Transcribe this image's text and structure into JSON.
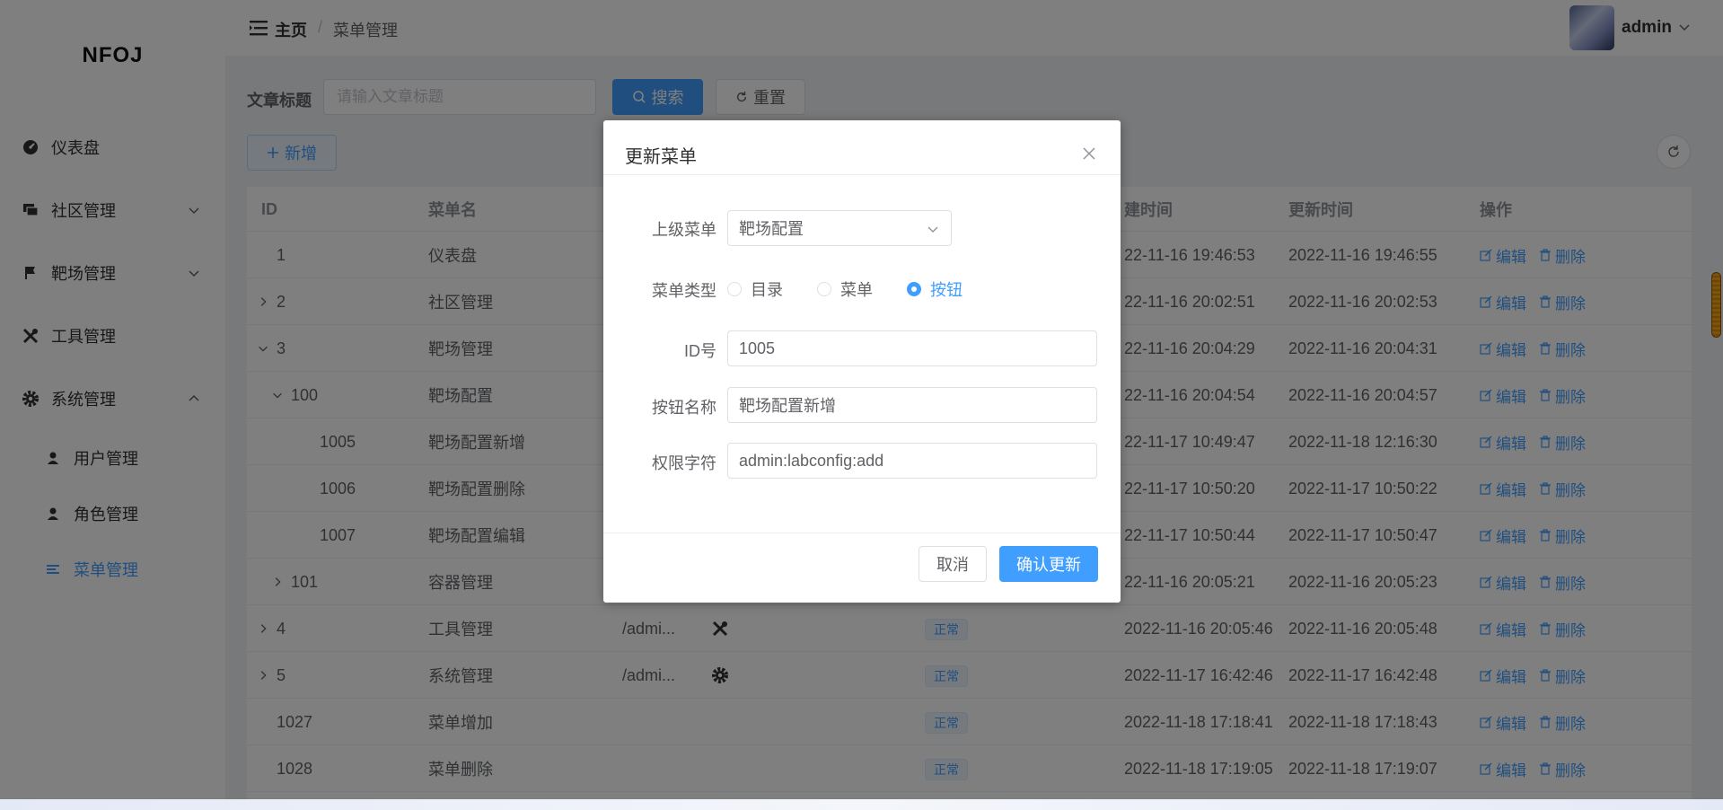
{
  "sidebar": {
    "logo": "NFOJ",
    "items": [
      {
        "label": "仪表盘",
        "icon": "dashboard-icon"
      },
      {
        "label": "社区管理",
        "icon": "chat-icon"
      },
      {
        "label": "靶场管理",
        "icon": "flag-icon"
      },
      {
        "label": "工具管理",
        "icon": "tools-icon"
      },
      {
        "label": "系统管理",
        "icon": "gear-icon"
      }
    ],
    "sub_items": [
      {
        "label": "用户管理",
        "icon": "user-icon"
      },
      {
        "label": "角色管理",
        "icon": "role-icon"
      },
      {
        "label": "菜单管理",
        "icon": "menu-icon",
        "active": true
      }
    ]
  },
  "header": {
    "breadcrumb_home": "主页",
    "breadcrumb_sep": "/",
    "breadcrumb_current": "菜单管理",
    "username": "admin"
  },
  "search": {
    "label": "文章标题",
    "placeholder": "请输入文章标题",
    "search_label": "搜索",
    "reset_label": "重置",
    "add_label": "新增"
  },
  "table": {
    "columns": [
      "ID",
      "菜单名",
      "",
      "",
      "",
      "建时间",
      "更新时间",
      "操作"
    ],
    "edit_label": "编辑",
    "delete_label": "删除",
    "rows": [
      {
        "id": "1",
        "name": "仪表盘",
        "path": "",
        "status": "",
        "created": "22-11-16 19:46:53",
        "updated": "2022-11-16 19:46:55"
      },
      {
        "id": "2",
        "name": "社区管理",
        "path": "",
        "status": "",
        "created": "22-11-16 20:02:51",
        "updated": "2022-11-16 20:02:53"
      },
      {
        "id": "3",
        "name": "靶场管理",
        "path": "",
        "status": "",
        "created": "22-11-16 20:04:29",
        "updated": "2022-11-16 20:04:31"
      },
      {
        "id": "100",
        "name": "靶场配置",
        "path": "",
        "status": "",
        "created": "22-11-16 20:04:54",
        "updated": "2022-11-16 20:04:57"
      },
      {
        "id": "1005",
        "name": "靶场配置新增",
        "path": "",
        "status": "",
        "created": "22-11-17 10:49:47",
        "updated": "2022-11-18 12:16:30"
      },
      {
        "id": "1006",
        "name": "靶场配置删除",
        "path": "",
        "status": "",
        "created": "22-11-17 10:50:20",
        "updated": "2022-11-17 10:50:22"
      },
      {
        "id": "1007",
        "name": "靶场配置编辑",
        "path": "",
        "status": "",
        "created": "22-11-17 10:50:44",
        "updated": "2022-11-17 10:50:47"
      },
      {
        "id": "101",
        "name": "容器管理",
        "path": "",
        "status": "",
        "created": "22-11-16 20:05:21",
        "updated": "2022-11-16 20:05:23"
      },
      {
        "id": "4",
        "name": "工具管理",
        "path": "/admi...",
        "status": "正常",
        "created": "2022-11-16 20:05:46",
        "updated": "2022-11-16 20:05:48"
      },
      {
        "id": "5",
        "name": "系统管理",
        "path": "/admi...",
        "status": "正常",
        "created": "2022-11-17 16:42:46",
        "updated": "2022-11-17 16:42:48"
      },
      {
        "id": "1027",
        "name": "菜单增加",
        "path": "",
        "status": "正常",
        "created": "2022-11-18 17:18:41",
        "updated": "2022-11-18 17:18:43"
      },
      {
        "id": "1028",
        "name": "菜单删除",
        "path": "",
        "status": "正常",
        "created": "2022-11-18 17:19:05",
        "updated": "2022-11-18 17:19:07"
      }
    ]
  },
  "dialog": {
    "title": "更新菜单",
    "parent_label": "上级菜单",
    "parent_value": "靶场配置",
    "type_label": "菜单类型",
    "type_options": [
      "目录",
      "菜单",
      "按钮"
    ],
    "type_selected": "按钮",
    "id_label": "ID号",
    "id_value": "1005",
    "name_label": "按钮名称",
    "name_value": "靶场配置新增",
    "perm_label": "权限字符",
    "perm_value": "admin:labconfig:add",
    "cancel_label": "取消",
    "confirm_label": "确认更新"
  },
  "colors": {
    "primary": "#409eff",
    "overlay": "rgba(0,0,0,0.5)"
  }
}
